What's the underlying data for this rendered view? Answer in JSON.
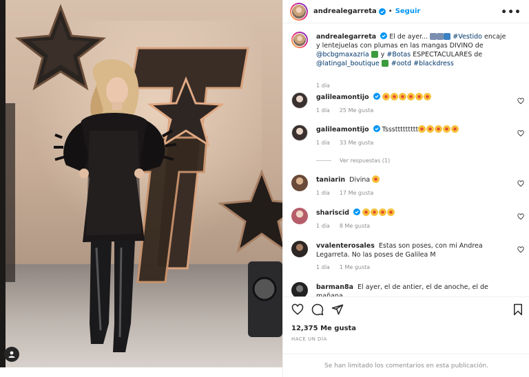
{
  "header": {
    "username": "andrealegarreta",
    "separator": "•",
    "follow_label": "Seguir",
    "more_label": "•••"
  },
  "caption": {
    "username": "andrealegarreta",
    "text_1": "El de ayer...",
    "hashtag_vestido": "#Vestido",
    "text_2": "encaje y lentejuelas con plumas en las mangas DIVINO de",
    "mention_1": "@bcbgmaxazria",
    "text_3": "y",
    "hashtag_botas": "#Botas",
    "text_4": "ESPECTACULARES de",
    "mention_2": "@latingal_boutique",
    "hashtag_ootd": "#ootd",
    "hashtag_blackdress": "#blackdress",
    "time": "1 día"
  },
  "comments": [
    {
      "username": "galileamontijo",
      "verified": true,
      "text": "",
      "time": "1 día",
      "likes": "25 Me gusta"
    },
    {
      "username": "galileamontijo",
      "verified": true,
      "text": "Tsssttttttttt",
      "time": "1 día",
      "likes": "33 Me gusta"
    },
    {
      "username": "taniarin",
      "verified": false,
      "text": "Divina",
      "time": "1 día",
      "likes": "17 Me gusta"
    },
    {
      "username": "shariscid",
      "verified": true,
      "text": "",
      "time": "1 día",
      "likes": "8 Me gusta"
    },
    {
      "username": "vvalenterosales",
      "verified": false,
      "text": "Estas son poses, con mi Andrea Legarreta. No las poses de Galilea M",
      "time": "1 día",
      "likes": "1 Me gusta"
    },
    {
      "username": "barman8a",
      "verified": false,
      "text": "El ayer, el de antier, el de anoche, el de mañana,",
      "time": "",
      "likes": ""
    }
  ],
  "replies_label": "Ver respuestas (1)",
  "icons": {
    "like": "heart-icon",
    "comment": "comment-icon",
    "share": "share-icon",
    "save": "bookmark-icon",
    "verified": "verified-badge-icon",
    "more": "more-options-icon"
  },
  "likes_count": "12,375 Me gusta",
  "post_date": "HACE UN DÍA",
  "footer_text": "Se han limitado los comentarios en esta publicación.",
  "colors": {
    "accent": "#0095f6",
    "verified": "#0095f6",
    "hashtag": "#00376b",
    "muted": "#8e8e8e",
    "text": "#262626"
  }
}
